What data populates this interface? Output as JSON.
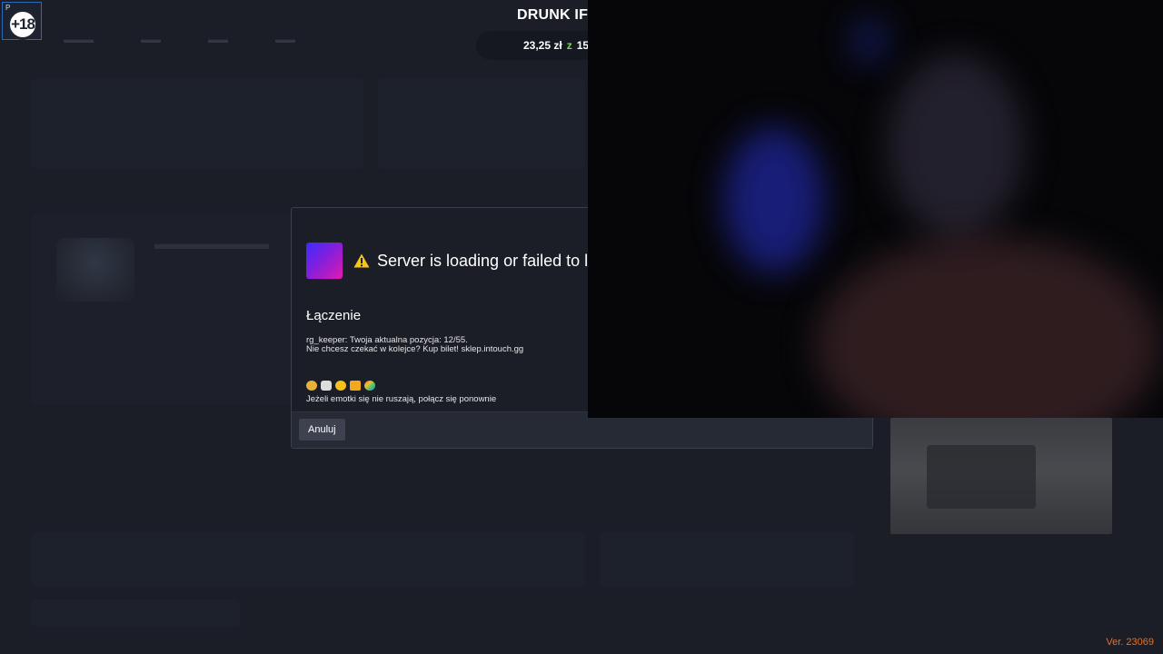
{
  "header": {
    "stream_title": "DRUNK IF",
    "money_amount": "23,25 zł",
    "money_currency": "z",
    "money_extra": "15"
  },
  "age_badge": {
    "corner_text": "P",
    "label": "+18"
  },
  "modal": {
    "title": "Server is loading or failed to lo",
    "status_label": "Łączenie",
    "queue_line1": "rg_keeper: Twoja aktualna pozycja: 12/55.",
    "queue_line2": "Nie chcesz czekać w kolejce? Kup bilet! sklep.intouch.gg",
    "emoji_hint": "Jeżeli emotki się nie ruszają, połącz się ponownie",
    "cancel_label": "Anuluj",
    "accent_colors": [
      "#3b2bff",
      "#e21ab0"
    ]
  },
  "version": "Ver. 23069"
}
